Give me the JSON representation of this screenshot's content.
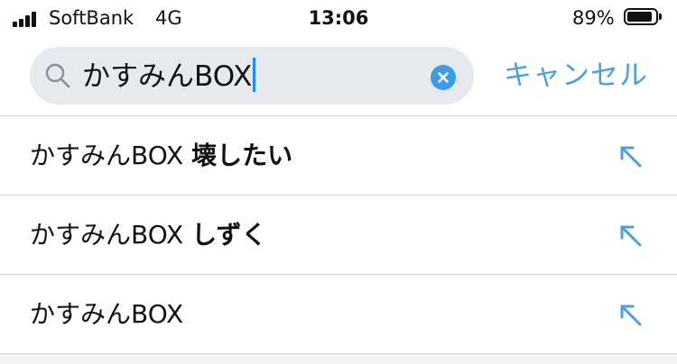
{
  "status_bar": {
    "carrier": "SoftBank",
    "network": "4G",
    "time": "13:06",
    "battery_percent": "89%"
  },
  "search": {
    "query": "かすみんBOX",
    "cancel_label": "キャンセル"
  },
  "suggestions": [
    {
      "prefix": "かすみんBOX",
      "suffix": "壊したい"
    },
    {
      "prefix": "かすみんBOX",
      "suffix": "しずく"
    },
    {
      "prefix": "かすみんBOX",
      "suffix": ""
    }
  ],
  "colors": {
    "accent": "#4b9ee3",
    "search_bg": "#e6e9ee",
    "divider": "#cfd4d9"
  },
  "icons": [
    "search-icon",
    "clear-icon",
    "fill-arrow-icon",
    "signal-icon",
    "battery-icon"
  ]
}
